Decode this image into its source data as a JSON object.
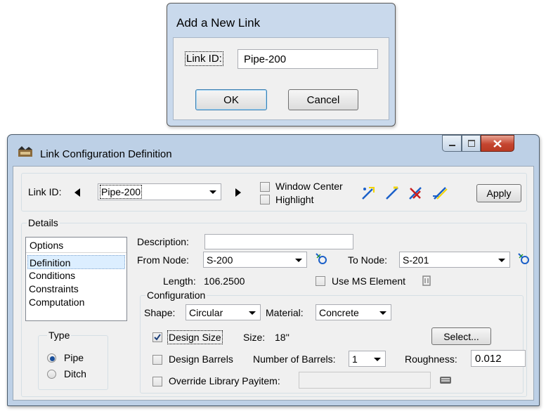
{
  "add_link_dialog": {
    "title": "Add a New Link",
    "link_id_label": "Link ID:",
    "link_id_value": "Pipe-200",
    "ok_label": "OK",
    "cancel_label": "Cancel"
  },
  "link_config_window": {
    "title": "Link Configuration Definition",
    "caption_buttons": [
      "minimize-icon",
      "maximize-icon",
      "close-icon"
    ],
    "header": {
      "link_id_label": "Link ID:",
      "link_id_value": "Pipe-200",
      "window_center_label": "Window Center",
      "highlight_label": "Highlight",
      "apply_label": "Apply",
      "tool_icons": [
        "link-draw-icon",
        "link-select-icon",
        "link-delete-icon",
        "link-edit-icon"
      ]
    },
    "details": {
      "group_label": "Details",
      "options_header": "Options",
      "options": [
        "Definition",
        "Conditions",
        "Constraints",
        "Computation"
      ],
      "selected_option": "Definition",
      "type_label": "Type",
      "type_options": [
        "Pipe",
        "Ditch"
      ],
      "type_selected": "Pipe",
      "description_label": "Description:",
      "description_value": "",
      "from_node_label": "From Node:",
      "from_node_value": "S-200",
      "to_node_label": "To Node:",
      "to_node_value": "S-201",
      "length_label": "Length:",
      "length_value": "106.2500",
      "use_ms_element_label": "Use MS Element",
      "use_ms_element_checked": false
    },
    "configuration": {
      "group_label": "Configuration",
      "shape_label": "Shape:",
      "shape_value": "Circular",
      "material_label": "Material:",
      "material_value": "Concrete",
      "design_size_label": "Design Size",
      "design_size_checked": true,
      "size_label": "Size:",
      "size_value": "18''",
      "select_label": "Select...",
      "design_barrels_label": "Design Barrels",
      "design_barrels_checked": false,
      "number_of_barrels_label": "Number of Barrels:",
      "number_of_barrels_value": "1",
      "roughness_label": "Roughness:",
      "roughness_value": "0.012",
      "override_payitem_label": "Override Library Payitem:",
      "override_payitem_checked": false,
      "override_payitem_value": ""
    }
  },
  "colors": {
    "window_frame": "#bdd0e6",
    "client_bg": "#f0f0f0",
    "close_button": "#c54530",
    "selection": "#dceeff",
    "tool_blue": "#1a5fc8",
    "tool_yellow": "#f2d400",
    "tool_red": "#c81e1e"
  }
}
